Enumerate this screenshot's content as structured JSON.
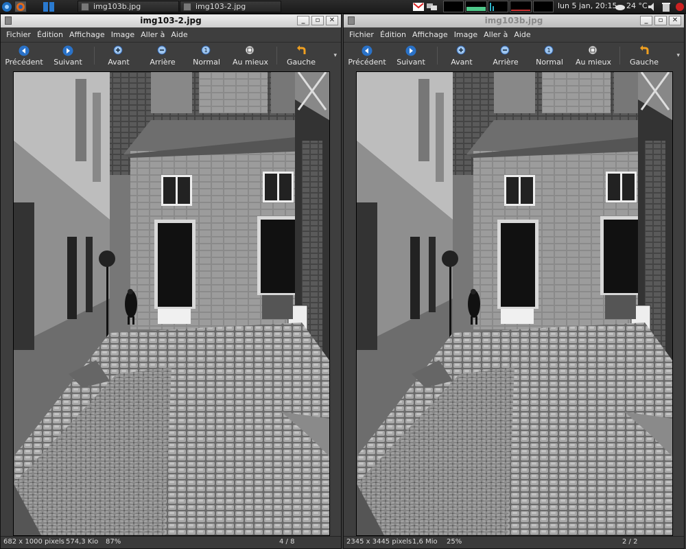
{
  "panel": {
    "tasks": [
      {
        "label": "img103b.jpg"
      },
      {
        "label": "img103-2.jpg"
      }
    ],
    "clock": "lun  5 jan, 20:15",
    "weather": "24 °C"
  },
  "colors": {
    "accent_blue": "#2a72c8",
    "icon_orange": "#f0a020",
    "tb_bg": "#3e3e3e"
  },
  "windows": [
    {
      "title": "img103-2.jpg",
      "active": true,
      "menu": [
        {
          "label": "Fichier"
        },
        {
          "label": "Édition"
        },
        {
          "label": "Affichage"
        },
        {
          "label": "Image"
        },
        {
          "label": "Aller à"
        },
        {
          "label": "Aide"
        }
      ],
      "toolbar": [
        {
          "label": "Précédent",
          "icon": "previous-icon"
        },
        {
          "label": "Suivant",
          "icon": "next-icon"
        },
        {
          "label": "Avant",
          "icon": "zoom-in-icon"
        },
        {
          "label": "Arrière",
          "icon": "zoom-out-icon"
        },
        {
          "label": "Normal",
          "icon": "zoom-normal-icon"
        },
        {
          "label": "Au mieux",
          "icon": "zoom-fit-icon"
        },
        {
          "label": "Gauche",
          "icon": "rotate-left-icon"
        }
      ],
      "status": {
        "dims": "682 x 1000 pixels",
        "size": "574,3 Kio",
        "zoom": "87%",
        "position": "4 / 8"
      }
    },
    {
      "title": "img103b.jpg",
      "active": false,
      "menu": [
        {
          "label": "Fichier"
        },
        {
          "label": "Édition"
        },
        {
          "label": "Affichage"
        },
        {
          "label": "Image"
        },
        {
          "label": "Aller à"
        },
        {
          "label": "Aide"
        }
      ],
      "toolbar": [
        {
          "label": "Précédent",
          "icon": "previous-icon"
        },
        {
          "label": "Suivant",
          "icon": "next-icon"
        },
        {
          "label": "Avant",
          "icon": "zoom-in-icon"
        },
        {
          "label": "Arrière",
          "icon": "zoom-out-icon"
        },
        {
          "label": "Normal",
          "icon": "zoom-normal-icon"
        },
        {
          "label": "Au mieux",
          "icon": "zoom-fit-icon"
        },
        {
          "label": "Gauche",
          "icon": "rotate-left-icon"
        }
      ],
      "status": {
        "dims": "2345 x 3445 pixels",
        "size": "1,6 Mio",
        "zoom": "25%",
        "position": "2 / 2"
      }
    }
  ]
}
